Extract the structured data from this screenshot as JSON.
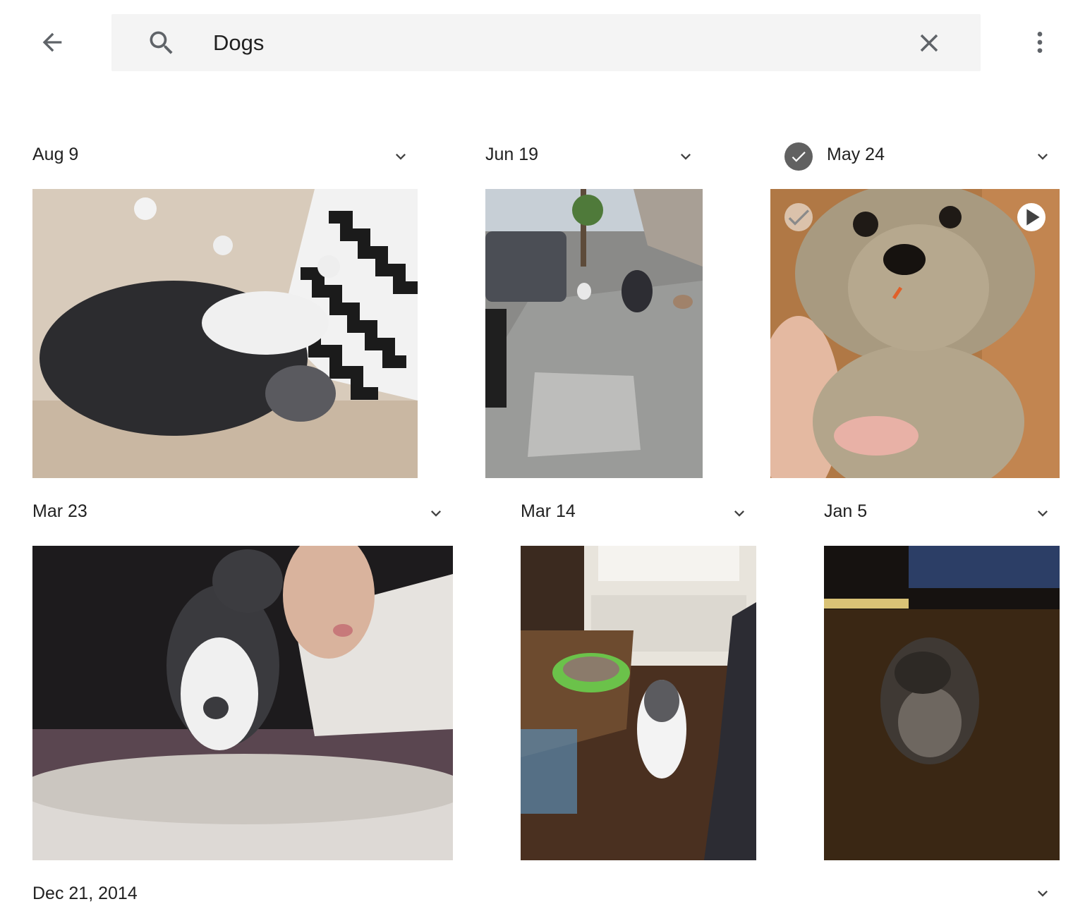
{
  "toolbar": {
    "back_icon": "arrow-back-icon",
    "more_icon": "more-vert-icon"
  },
  "search": {
    "icon": "search-icon",
    "value": "Dogs",
    "clear_icon": "close-icon"
  },
  "groups": [
    {
      "date": "Aug 9",
      "photo": "Cat sleeping on a couch next to a black and white zigzag pillow"
    },
    {
      "date": "Jun 19",
      "photo": "Person crouching on a sidewalk with two dogs on leashes"
    },
    {
      "date": "May 24",
      "photo": "Hand holding a plush toy dog",
      "selected": true,
      "is_video": true
    },
    {
      "date": "Mar 23",
      "photo": "Woman kissing a gray and white cat"
    },
    {
      "date": "Mar 14",
      "photo": "Cat standing on hind legs near a table"
    },
    {
      "date": "Jan 5",
      "photo": "Cat sitting on a wooden floor in dim light"
    },
    {
      "date": "Dec 21, 2014"
    }
  ],
  "colors": {
    "search_bg": "#f4f4f4",
    "icon_gray": "#5f6368",
    "select_check": "#616161"
  }
}
